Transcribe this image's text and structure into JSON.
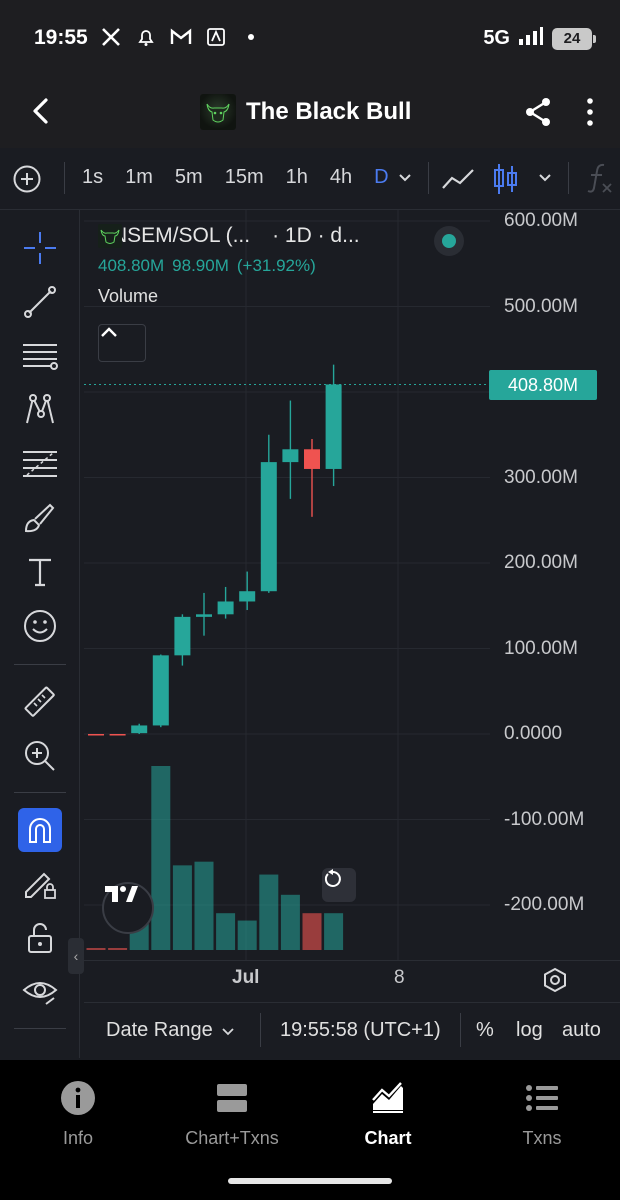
{
  "status": {
    "time": "19:55",
    "network": "5G",
    "battery": "24"
  },
  "header": {
    "title": "The Black Bull"
  },
  "intervals": [
    "1s",
    "1m",
    "5m",
    "15m",
    "1h",
    "4h",
    "D"
  ],
  "active_interval": "D",
  "legend": {
    "symbol": "ANSEM/SOL (...",
    "meta": "· 1D · d...",
    "price": "408.80M",
    "change": "98.90M",
    "change_pct": "(+31.92%)",
    "volume_label": "Volume"
  },
  "price_tag": "408.80M",
  "xaxis": {
    "jul": "Jul",
    "eight": "8"
  },
  "controls": {
    "date_range": "Date Range",
    "clock": "19:55:58 (UTC+1)",
    "pct": "%",
    "log": "log",
    "auto": "auto"
  },
  "nav": [
    {
      "label": "Info",
      "icon": "info-icon"
    },
    {
      "label": "Chart+Txns",
      "icon": "split-view-icon"
    },
    {
      "label": "Chart",
      "icon": "area-chart-icon"
    },
    {
      "label": "Txns",
      "icon": "list-icon"
    }
  ],
  "colors": {
    "up": "#26a69a",
    "down": "#ef5350",
    "accent": "#2f63e8"
  },
  "chart_data": {
    "type": "candlestick",
    "ylim": [
      -250000000,
      600000000
    ],
    "y_ticks": [
      "600.00M",
      "500.00M",
      "400.00M",
      "300.00M",
      "200.00M",
      "100.00M",
      "0.0000",
      "-100.00M",
      "-200.00M"
    ],
    "y_tick_values": [
      600000000,
      500000000,
      400000000,
      300000000,
      200000000,
      100000000,
      0,
      -100000000,
      -200000000
    ],
    "x_labels": [
      "Jul",
      "8"
    ],
    "candles": [
      {
        "o": 0,
        "h": 0,
        "l": 0,
        "c": 0,
        "dir": "down"
      },
      {
        "o": 0,
        "h": 0,
        "l": 0,
        "c": 0,
        "dir": "down"
      },
      {
        "o": 1000000,
        "h": 12000000,
        "l": 0,
        "c": 10000000,
        "dir": "up"
      },
      {
        "o": 10000000,
        "h": 93000000,
        "l": 8000000,
        "c": 92000000,
        "dir": "up"
      },
      {
        "o": 92000000,
        "h": 140000000,
        "l": 80000000,
        "c": 137000000,
        "dir": "up"
      },
      {
        "o": 137000000,
        "h": 165000000,
        "l": 115000000,
        "c": 140000000,
        "dir": "up"
      },
      {
        "o": 140000000,
        "h": 172000000,
        "l": 135000000,
        "c": 155000000,
        "dir": "up"
      },
      {
        "o": 155000000,
        "h": 190000000,
        "l": 145000000,
        "c": 167000000,
        "dir": "up"
      },
      {
        "o": 167000000,
        "h": 350000000,
        "l": 165000000,
        "c": 318000000,
        "dir": "up"
      },
      {
        "o": 318000000,
        "h": 390000000,
        "l": 275000000,
        "c": 333000000,
        "dir": "up"
      },
      {
        "o": 333000000,
        "h": 345000000,
        "l": 254000000,
        "c": 310000000,
        "dir": "down"
      },
      {
        "o": 310000000,
        "h": 432000000,
        "l": 290000000,
        "c": 408800000,
        "dir": "up"
      }
    ],
    "volumes": [
      0.01,
      0.01,
      0.17,
      1.0,
      0.46,
      0.48,
      0.2,
      0.16,
      0.41,
      0.3,
      0.2,
      0.2
    ],
    "last_price": 408800000
  }
}
